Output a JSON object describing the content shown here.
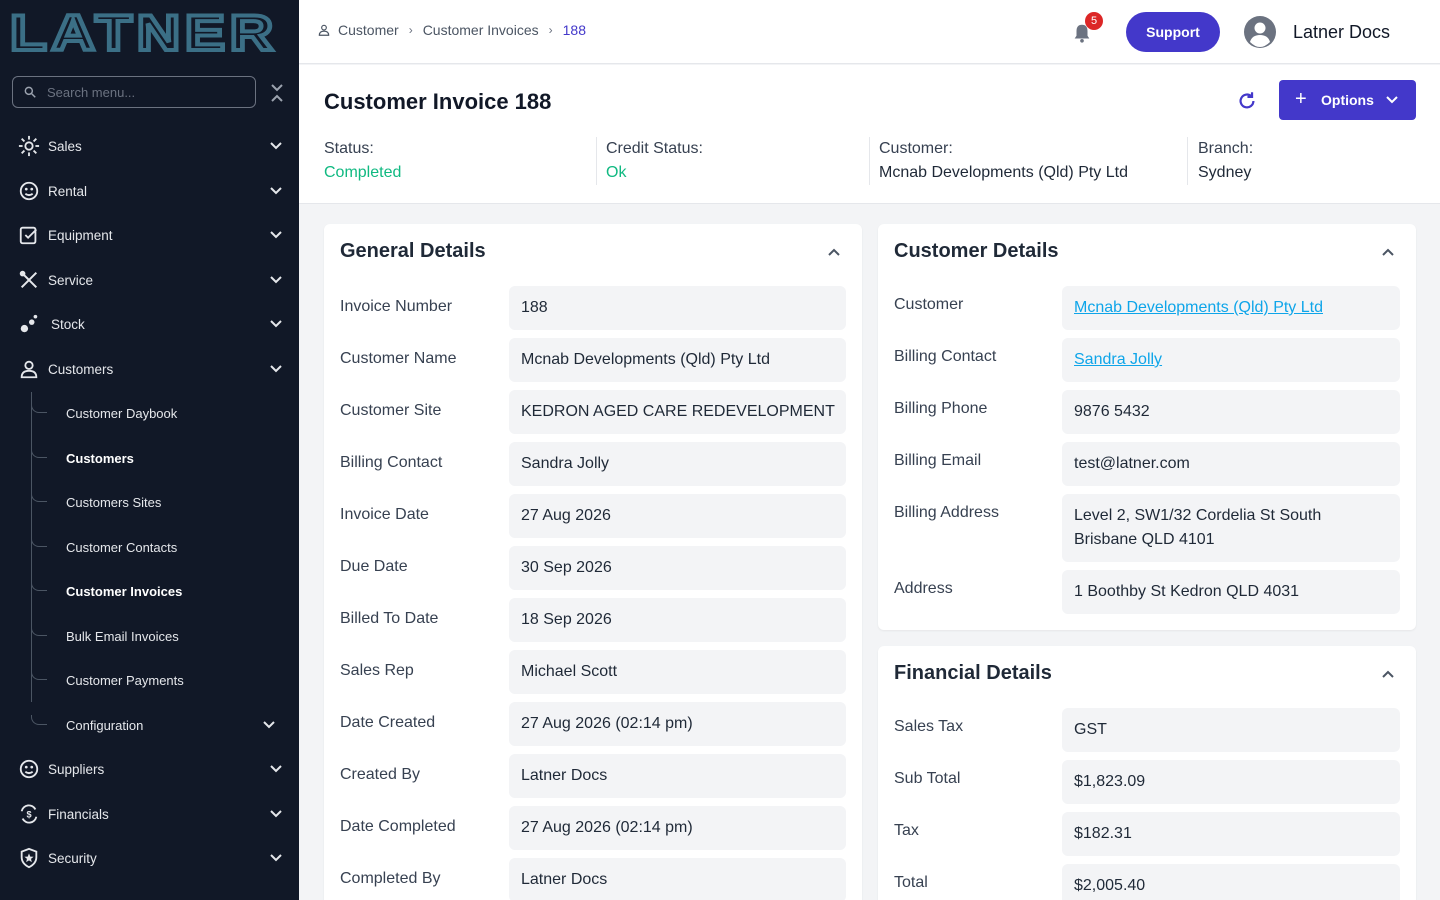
{
  "sidebar": {
    "logo_text": "LATNER",
    "search_placeholder": "Search menu...",
    "items": [
      {
        "label": "Sales",
        "icon": "sales-icon"
      },
      {
        "label": "Rental",
        "icon": "rental-icon"
      },
      {
        "label": "Equipment",
        "icon": "equipment-icon"
      },
      {
        "label": "Service",
        "icon": "service-icon"
      },
      {
        "label": "Stock",
        "icon": "stock-icon"
      },
      {
        "label": "Customers",
        "icon": "customers-icon"
      },
      {
        "label": "Suppliers",
        "icon": "suppliers-icon"
      },
      {
        "label": "Financials",
        "icon": "financials-icon"
      },
      {
        "label": "Security",
        "icon": "security-icon"
      }
    ],
    "customers_sub": [
      {
        "label": "Customer Daybook"
      },
      {
        "label": "Customers"
      },
      {
        "label": "Customers Sites"
      },
      {
        "label": "Customer Contacts"
      },
      {
        "label": "Customer Invoices"
      },
      {
        "label": "Bulk Email Invoices"
      },
      {
        "label": "Customer Payments"
      },
      {
        "label": "Configuration"
      }
    ]
  },
  "header": {
    "breadcrumb": [
      "Customer",
      "Customer Invoices",
      "188"
    ],
    "notification_count": "5",
    "support_label": "Support",
    "user_name": "Latner Docs"
  },
  "invoice": {
    "title": "Customer Invoice",
    "number": "188",
    "options_label": "Options",
    "status_label": "Status:",
    "status_value": "Completed",
    "credit_label": "Credit Status:",
    "credit_value": "Ok",
    "customer_label": "Customer:",
    "customer_value": "Mcnab Developments (Qld) Pty Ltd",
    "branch_label": "Branch:",
    "branch_value": "Sydney"
  },
  "general": {
    "title": "General Details",
    "rows": [
      {
        "label": "Invoice Number",
        "value": "188"
      },
      {
        "label": "Customer Name",
        "value": "Mcnab Developments (Qld) Pty Ltd"
      },
      {
        "label": "Customer Site",
        "value": "KEDRON AGED CARE REDEVELOPMENT"
      },
      {
        "label": "Billing Contact",
        "value": "Sandra Jolly"
      },
      {
        "label": "Invoice Date",
        "value": "27 Aug 2026"
      },
      {
        "label": "Due Date",
        "value": "30 Sep 2026"
      },
      {
        "label": "Billed To Date",
        "value": "18 Sep 2026"
      },
      {
        "label": "Sales Rep",
        "value": "Michael Scott"
      },
      {
        "label": "Date Created",
        "value": "27 Aug 2026 (02:14 pm)"
      },
      {
        "label": "Created By",
        "value": "Latner Docs"
      },
      {
        "label": "Date Completed",
        "value": "27 Aug 2026 (02:14 pm)"
      },
      {
        "label": "Completed By",
        "value": "Latner Docs"
      }
    ]
  },
  "customer_details": {
    "title": "Customer Details",
    "rows": [
      {
        "label": "Customer",
        "value": "Mcnab Developments (Qld) Pty Ltd"
      },
      {
        "label": "Billing Contact",
        "value": "Sandra Jolly"
      },
      {
        "label": "Billing Phone",
        "value": "9876 5432"
      },
      {
        "label": "Billing Email",
        "value": "test@latner.com"
      },
      {
        "label": "Billing Address",
        "value_line1": "Level 2, SW1/32 Cordelia St South",
        "value_line2": "Brisbane QLD 4101"
      },
      {
        "label": "Address",
        "value": "1 Boothby St Kedron QLD 4031"
      }
    ]
  },
  "financial": {
    "title": "Financial Details",
    "rows": [
      {
        "label": "Sales Tax",
        "value": "GST"
      },
      {
        "label": "Sub Total",
        "value": "$1,823.09"
      },
      {
        "label": "Tax",
        "value": "$182.31"
      },
      {
        "label": "Total",
        "value": "$2,005.40"
      }
    ]
  },
  "colors": {
    "sidebar_bg": "#111827",
    "accent": "#4338ca",
    "status_green": "#10b981",
    "link": "#0ea5e9",
    "badge": "#dc2626"
  }
}
